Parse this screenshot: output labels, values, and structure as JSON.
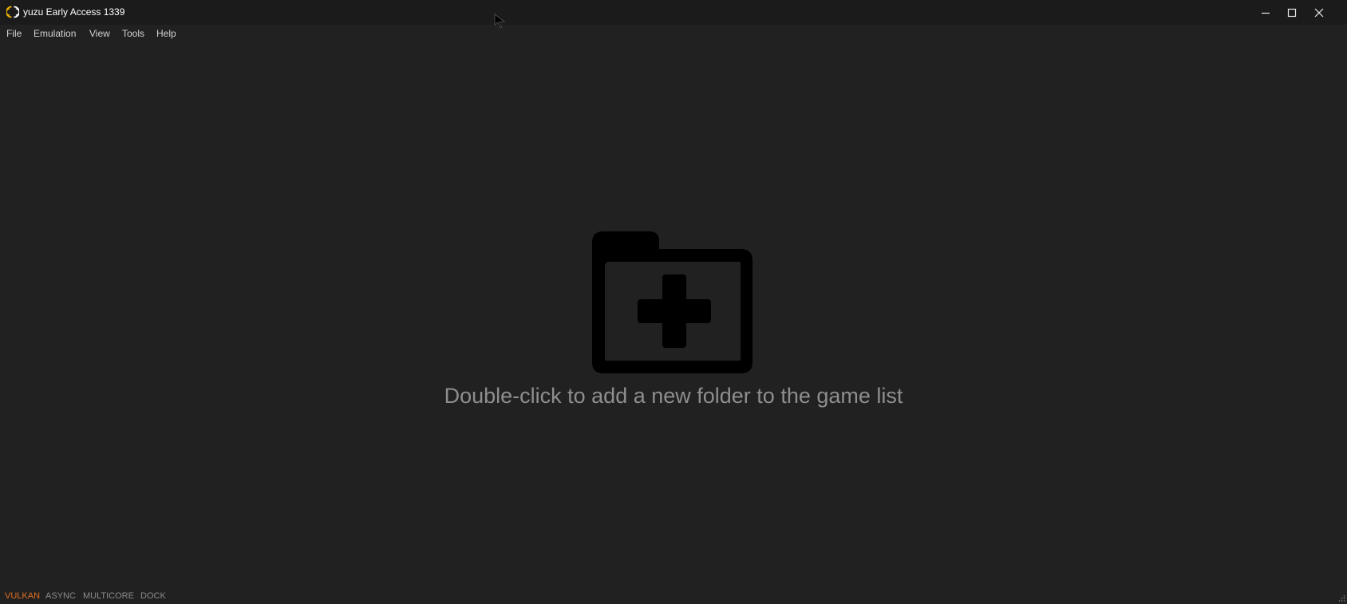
{
  "window": {
    "title": "yuzu Early Access 1339",
    "icon": "yuzu-logo-icon",
    "controls": [
      "minimize-icon",
      "maximize-icon",
      "close-icon"
    ]
  },
  "menu": {
    "items": [
      "File",
      "Emulation",
      "View",
      "Tools",
      "Help"
    ]
  },
  "game_list": {
    "empty_icon": "folder-add-icon",
    "empty_message": "Double-click to add a new folder to the game list"
  },
  "status": {
    "items": [
      {
        "label": "VULKAN",
        "active": true
      },
      {
        "label": "ASYNC",
        "active": false
      },
      {
        "label": "MULTICORE",
        "active": false
      },
      {
        "label": "DOCK",
        "active": false
      }
    ]
  },
  "colors": {
    "background": "#212121",
    "titlebar": "#1b1b1b",
    "accent_active": "#e07020",
    "logo": "#f0b400"
  }
}
